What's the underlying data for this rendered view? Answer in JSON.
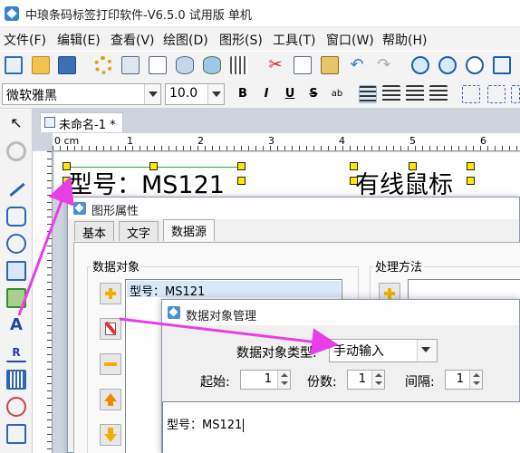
{
  "window": {
    "title": "中琅条码标签打印软件-V6.5.0 试用版 单机"
  },
  "menu": [
    "文件(F)",
    "编辑(E)",
    "查看(V)",
    "绘图(D)",
    "图形(S)",
    "工具(T)",
    "窗口(W)",
    "帮助(H)"
  ],
  "format_bar": {
    "font_family": "微软雅黑",
    "font_size": "10.0",
    "bold": "B",
    "italic": "I",
    "underline": "U",
    "strike": "S",
    "spacing": "ab"
  },
  "document": {
    "tab_title": "未命名-1 *"
  },
  "ruler": {
    "unit": "0 cm",
    "marks": [
      "1",
      "2",
      "3",
      "4",
      "5",
      "6"
    ]
  },
  "canvas": {
    "text1": "型号：MS121",
    "text2": "有线鼠标"
  },
  "properties_dialog": {
    "title": "图形属性",
    "tabs": [
      "基本",
      "文字",
      "数据源"
    ],
    "active_tab": "数据源",
    "data_objects_label": "数据对象",
    "processing_label": "处理方法",
    "list_item": "型号：MS121"
  },
  "data_object_dialog": {
    "title": "数据对象管理",
    "type_label": "数据对象类型:",
    "type_value": "手动输入",
    "start_label": "起始:",
    "start_value": "1",
    "copies_label": "份数:",
    "copies_value": "1",
    "interval_label": "间隔:",
    "interval_value": "1",
    "content": "型号：MS121"
  },
  "colors": {
    "accent": "#3b82d6",
    "arrow": "#e83ee8",
    "handle": "#ffe800",
    "selection": "#2fa52f"
  }
}
